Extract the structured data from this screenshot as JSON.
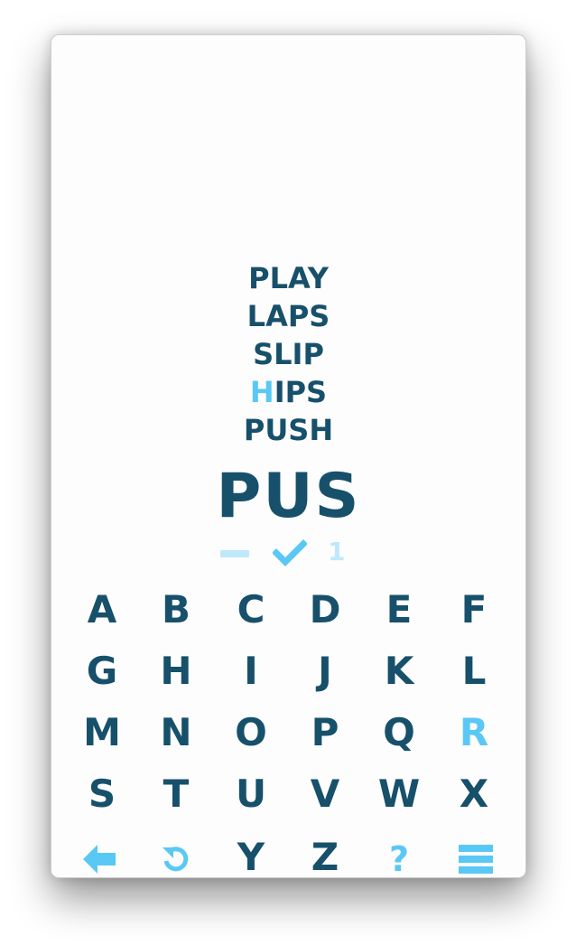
{
  "history": {
    "words": [
      {
        "highlight": "",
        "rest": "PLAY"
      },
      {
        "highlight": "",
        "rest": "LAPS"
      },
      {
        "highlight": "",
        "rest": "SLIP"
      },
      {
        "highlight": "H",
        "rest": "IPS"
      },
      {
        "highlight": "",
        "rest": "PUSH"
      }
    ]
  },
  "current_word": "PUS",
  "status": {
    "count": "1"
  },
  "keyboard": {
    "rows": [
      [
        "A",
        "B",
        "C",
        "D",
        "E",
        "F"
      ],
      [
        "G",
        "H",
        "I",
        "J",
        "K",
        "L"
      ],
      [
        "M",
        "N",
        "O",
        "P",
        "Q",
        "R"
      ],
      [
        "S",
        "T",
        "U",
        "V",
        "W",
        "X"
      ],
      [
        "Y",
        "Z"
      ]
    ],
    "highlighted_letter": "R",
    "help_label": "?"
  },
  "colors": {
    "primary": "#17506b",
    "accent": "#5ac8f5",
    "faded": "#bfe8fb"
  },
  "icons": {
    "back": "arrow-left-icon",
    "undo": "undo-icon",
    "menu": "hamburger-menu-icon",
    "confirm": "checkmark-icon",
    "clear": "dash-icon"
  }
}
